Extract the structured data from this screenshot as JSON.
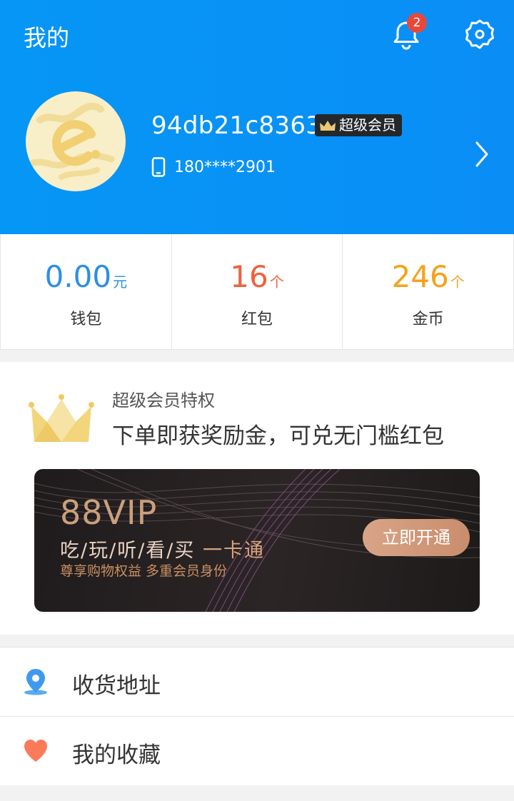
{
  "header": {
    "title": "我的",
    "notification_count": "2",
    "username": "94db21c8363",
    "vip_tag": "超级会员",
    "phone": "180****2901"
  },
  "stats": [
    {
      "value": "0.00",
      "unit": "元",
      "label": "钱包",
      "color": "#2b8ee8"
    },
    {
      "value": "16",
      "unit": "个",
      "label": "红包",
      "color": "#f0603c"
    },
    {
      "value": "246",
      "unit": "个",
      "label": "金币",
      "color": "#f5a21b"
    }
  ],
  "privilege": {
    "subtitle": "超级会员特权",
    "title": "下单即获奖励金，可兑无门槛红包",
    "card": {
      "brand": "88VIP",
      "line1": "吃/玩/听/看/买",
      "line1_highlight": "一卡通",
      "line2": "尊享购物权益 多重会员身份",
      "button": "立即开通"
    }
  },
  "menu": [
    {
      "label": "收货地址",
      "icon": "location-pin-icon"
    },
    {
      "label": "我的收藏",
      "icon": "heart-icon"
    }
  ],
  "colors": {
    "header_blue": "#0a8ef6",
    "badge_red": "#e8483b",
    "wallet_blue": "#2b8ee8",
    "redpacket_red": "#f0603c",
    "coin_orange": "#f5a21b"
  }
}
